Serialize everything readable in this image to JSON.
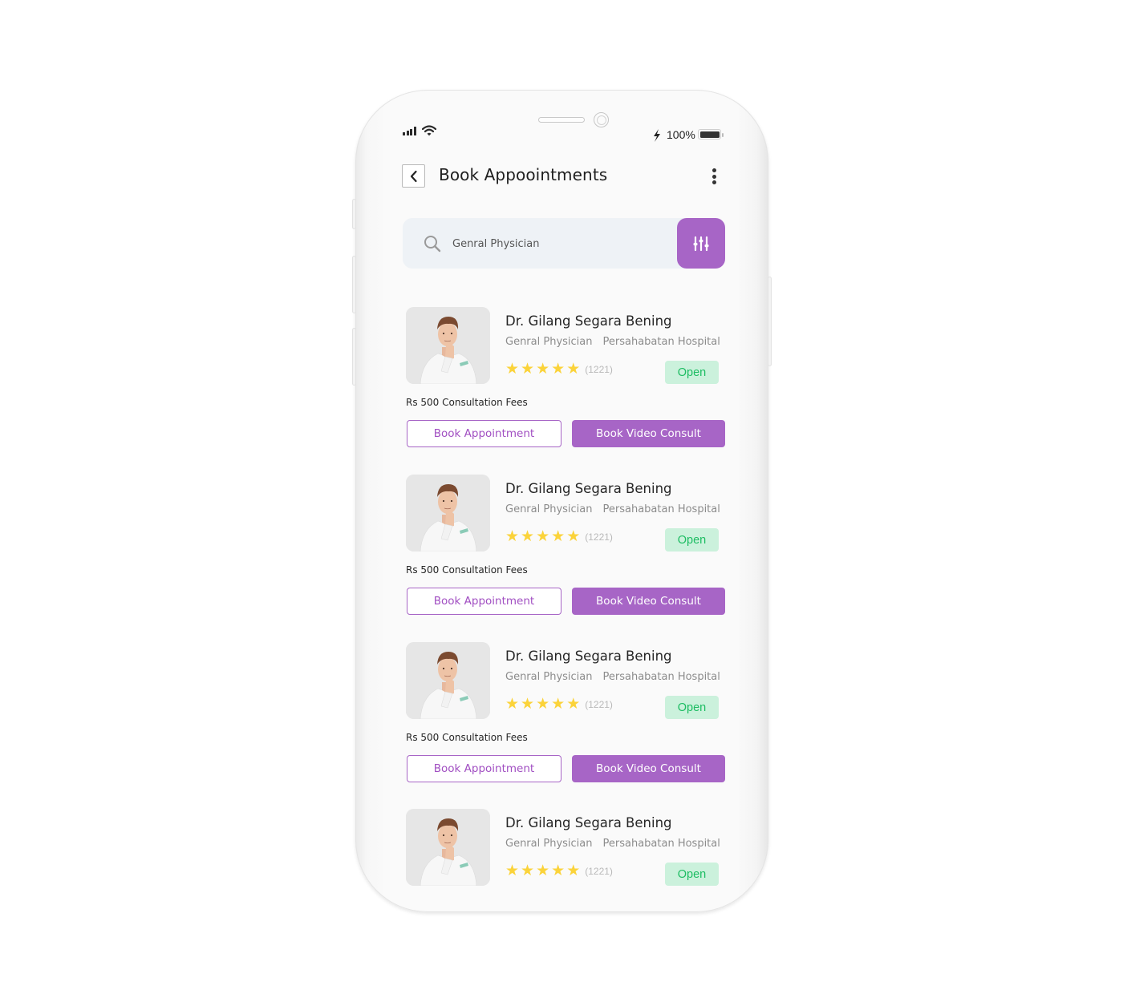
{
  "status_bar": {
    "battery_percent": "100%",
    "icons": [
      "signal-icon",
      "wifi-icon",
      "charging-icon",
      "battery-icon"
    ]
  },
  "header": {
    "back_icon": "chevron-left-icon",
    "title": "Book Appoointments",
    "menu_icon": "more-vertical-icon"
  },
  "search": {
    "icon": "search-icon",
    "value": "Genral Physician",
    "placeholder": "Genral Physician",
    "filter_icon": "sliders-icon"
  },
  "colors": {
    "accent": "#a765c6",
    "open_bg": "#cbf1dc",
    "open_text": "#1ebd63",
    "star": "#fbd33a",
    "search_bg": "#eef2f6"
  },
  "doctors": [
    {
      "name": "Dr. Gilang Segara Bening",
      "specialty": "Genral Physician",
      "hospital": "Persahabatan Hospital",
      "rating_stars": 5,
      "star_glyph": "★",
      "rating_count": "(1221)",
      "status": "Open",
      "fees": "Rs 500 Consultation Fees",
      "book_label": "Book Appointment",
      "video_label": "Book Video Consult"
    },
    {
      "name": "Dr. Gilang Segara Bening",
      "specialty": "Genral Physician",
      "hospital": "Persahabatan Hospital",
      "rating_stars": 5,
      "star_glyph": "★",
      "rating_count": "(1221)",
      "status": "Open",
      "fees": "Rs 500 Consultation Fees",
      "book_label": "Book Appointment",
      "video_label": "Book Video Consult"
    },
    {
      "name": "Dr. Gilang Segara Bening",
      "specialty": "Genral Physician",
      "hospital": "Persahabatan Hospital",
      "rating_stars": 5,
      "star_glyph": "★",
      "rating_count": "(1221)",
      "status": "Open",
      "fees": "Rs 500 Consultation Fees",
      "book_label": "Book Appointment",
      "video_label": "Book Video Consult"
    },
    {
      "name": "Dr. Gilang Segara Bening",
      "specialty": "Genral Physician",
      "hospital": "Persahabatan Hospital",
      "rating_stars": 5,
      "star_glyph": "★",
      "rating_count": "(1221)",
      "status": "Open"
    }
  ]
}
